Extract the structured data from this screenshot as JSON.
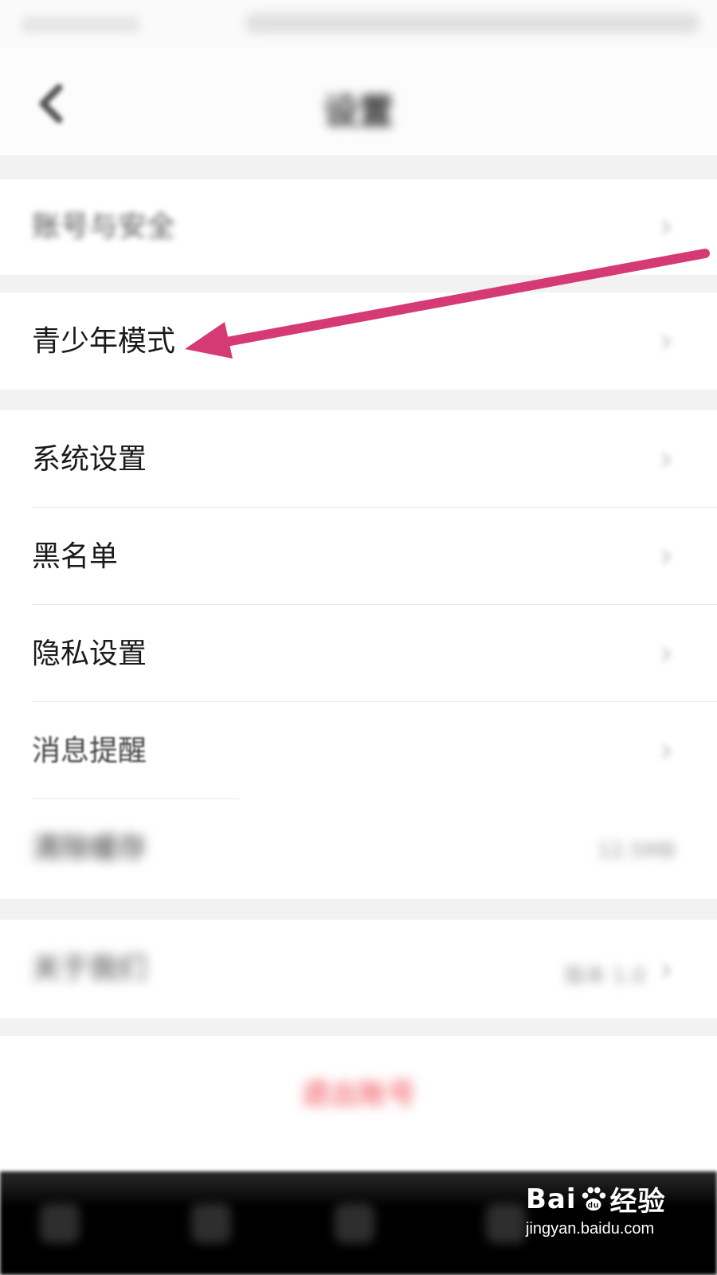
{
  "header": {
    "title": "设置",
    "back_icon": "chevron-left-icon"
  },
  "settings": {
    "items": [
      {
        "label": "账号与安全",
        "icon": "chevron-right-icon"
      },
      {
        "label": "青少年模式",
        "icon": "chevron-right-icon"
      },
      {
        "label": "系统设置",
        "icon": "chevron-right-icon"
      },
      {
        "label": "黑名单",
        "icon": "chevron-right-icon"
      },
      {
        "label": "隐私设置",
        "icon": "chevron-right-icon"
      },
      {
        "label": "消息提醒",
        "icon": "chevron-right-icon"
      },
      {
        "label": "清除缓存",
        "value": "12.5MB"
      },
      {
        "label": "关于我们",
        "value": "版本 1.0",
        "icon": "chevron-right-icon"
      }
    ]
  },
  "logout": {
    "label": "退出账号"
  },
  "watermark": {
    "logo_text_left": "Bai",
    "logo_text_right": "经验",
    "url": "jingyan.baidu.com"
  },
  "colors": {
    "annotation_arrow": "#d63a75",
    "logout_red": "#f0404a",
    "section_gap": "#f2f2f2"
  }
}
